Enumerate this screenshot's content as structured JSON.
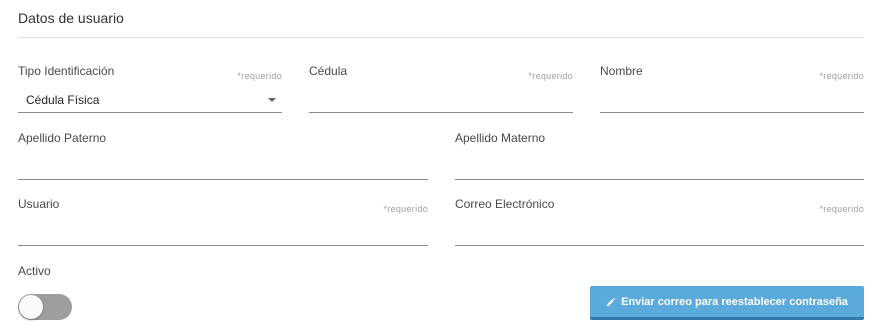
{
  "section": {
    "title": "Datos de usuario"
  },
  "fields": {
    "tipo": {
      "label": "Tipo Identificación",
      "required": "*requerido",
      "value": "Cédula Física"
    },
    "cedula": {
      "label": "Cédula",
      "required": "*requerido"
    },
    "nombre": {
      "label": "Nombre",
      "required": "*requerido"
    },
    "apellido_paterno": {
      "label": "Apellido Paterno"
    },
    "apellido_materno": {
      "label": "Apellido Materno"
    },
    "usuario": {
      "label": "Usuario",
      "required": "*requerido"
    },
    "correo": {
      "label": "Correo Electrónico",
      "required": "*requerido"
    }
  },
  "activo": {
    "label": "Activo",
    "checked": false
  },
  "actions": {
    "reset_password_label": "Enviar correo para reestablecer contraseña",
    "icon": "pencil-icon"
  },
  "colors": {
    "button": "#5aabdc",
    "button_border": "#2f7cab",
    "toggle_off": "#9e9e9e"
  }
}
